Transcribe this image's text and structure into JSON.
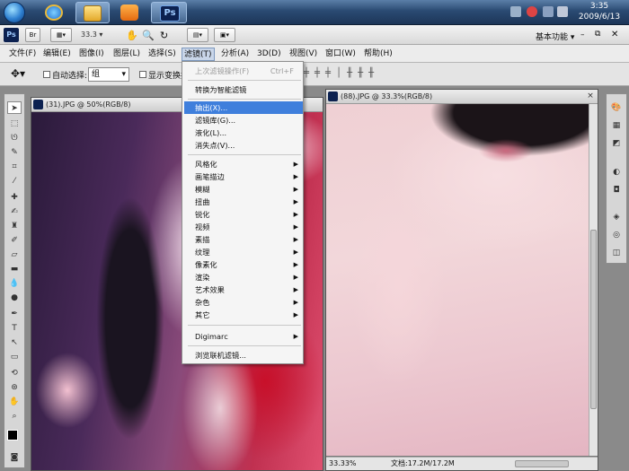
{
  "taskbar": {
    "clock_time": "3:35",
    "clock_date": "2009/6/13",
    "ps_label": "Ps"
  },
  "app_bar": {
    "logo": "Ps",
    "br_label": "Br",
    "zoom": "33.3",
    "workspace": "基本功能"
  },
  "menubar": {
    "items": [
      "文件(F)",
      "编辑(E)",
      "图像(I)",
      "图层(L)",
      "选择(S)",
      "滤镜(T)",
      "分析(A)",
      "3D(D)",
      "视图(V)",
      "窗口(W)",
      "帮助(H)"
    ]
  },
  "options_bar": {
    "auto_select_label": "自动选择:",
    "auto_select_value": "组",
    "transform_label": "显示变换控"
  },
  "doc1": {
    "title": "(31).JPG @ 50%(RGB/8)"
  },
  "doc2": {
    "title": "(88).JPG @ 33.3%(RGB/8)",
    "zoom_status": "33.33%",
    "doc_size": "文档:17.2M/17.2M"
  },
  "filter_menu": {
    "last_filter": "上次滤镜操作(F)",
    "last_filter_shortcut": "Ctrl+F",
    "convert_smart": "转换为智能滤镜",
    "extract": "抽出(X)...",
    "gallery": "滤镜库(G)...",
    "liquify": "液化(L)...",
    "vanishing": "消失点(V)...",
    "submenus": [
      "风格化",
      "画笔描边",
      "模糊",
      "扭曲",
      "锐化",
      "视频",
      "素描",
      "纹理",
      "像素化",
      "渲染",
      "艺术效果",
      "杂色",
      "其它"
    ],
    "digimarc": "Digimarc",
    "browse_online": "浏览联机滤镜..."
  },
  "colors": {
    "highlight": "#3f7fdc",
    "ps_dark": "#0c2150"
  }
}
